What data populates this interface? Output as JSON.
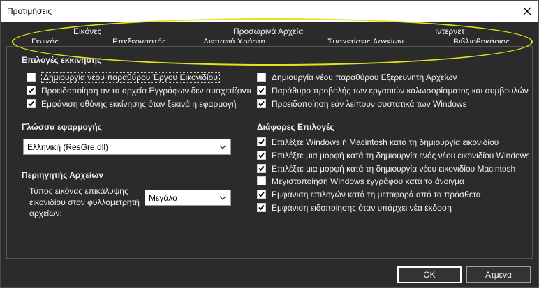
{
  "window": {
    "title": "Προτιμήσεις",
    "close_label": "✕"
  },
  "tabs": {
    "row1": [
      "Εικόνες",
      "Προσωρινά Αρχεία",
      "Ιντερνετ"
    ],
    "row2": [
      "Γενικός",
      "Επεξεργαστής",
      "Διεπαφή Χρήστη",
      "Συσχετίσεις Αρχείων",
      "Βιβλιοθηκάριος"
    ]
  },
  "startup": {
    "title": "Επιλογές εκκίνησης",
    "left": [
      {
        "label": "Δημιουργία νέου παραθύρου Έργου Εικονιδίου",
        "checked": false
      },
      {
        "label": "Προειδοποίηση αν τα αρχεία Εγγράφων δεν συσχετίζονται",
        "checked": true
      },
      {
        "label": "Εμφάνιση οθόνης εκκίνησης όταν ξεκινά η εφαρμογή",
        "checked": true
      }
    ],
    "right": [
      {
        "label": "Δημιουργία νέου παραθύρου Εξερευνητή Αρχείων",
        "checked": false
      },
      {
        "label": "Παράθυρο προβολής των εργασιών καλωσορίσματος και συμβουλών",
        "checked": true
      },
      {
        "label": "Προειδοποίηση εάν λείπουν συστατικά των Windows",
        "checked": true
      }
    ]
  },
  "language": {
    "title": "Γλώσσα εφαρμογής",
    "selected": "Ελληνική (ResGre.dll)"
  },
  "explorer": {
    "title": "Περιηγητής Αρχείων",
    "label": "Τύπος εικόνας επικάλυψης εικονιδίου στον φυλλομετρητή αρχείων:",
    "selected": "Μεγάλο"
  },
  "misc": {
    "title": "Διάφορες Επιλογές",
    "items": [
      {
        "label": "Επιλέξτε Windows ή Macintosh κατά τη δημιουργία εικονιδίου",
        "checked": true
      },
      {
        "label": "Επιλέξτε μια μορφή κατά τη δημιουργία ενός νέου εικονιδίου Windows",
        "checked": true
      },
      {
        "label": "Επιλέξτε μια μορφή κατά τη δημιουργία νέου εικονιδίου Macintosh",
        "checked": true
      },
      {
        "label": "Μεγιστοποίηση Windows εγγράφου κατά το άνοιγμα",
        "checked": false
      },
      {
        "label": "Εμφάνιση επιλογών κατά τη μεταφορά από τα πρόσθετα",
        "checked": true
      },
      {
        "label": "Εμφάνιση ειδοποίησης όταν υπάρχει νέα έκδοση",
        "checked": true
      }
    ]
  },
  "buttons": {
    "ok": "OK",
    "cancel": "Ατμενα"
  },
  "colors": {
    "background": "#2b2b2b",
    "highlight_ellipse": "#e5e21c"
  }
}
